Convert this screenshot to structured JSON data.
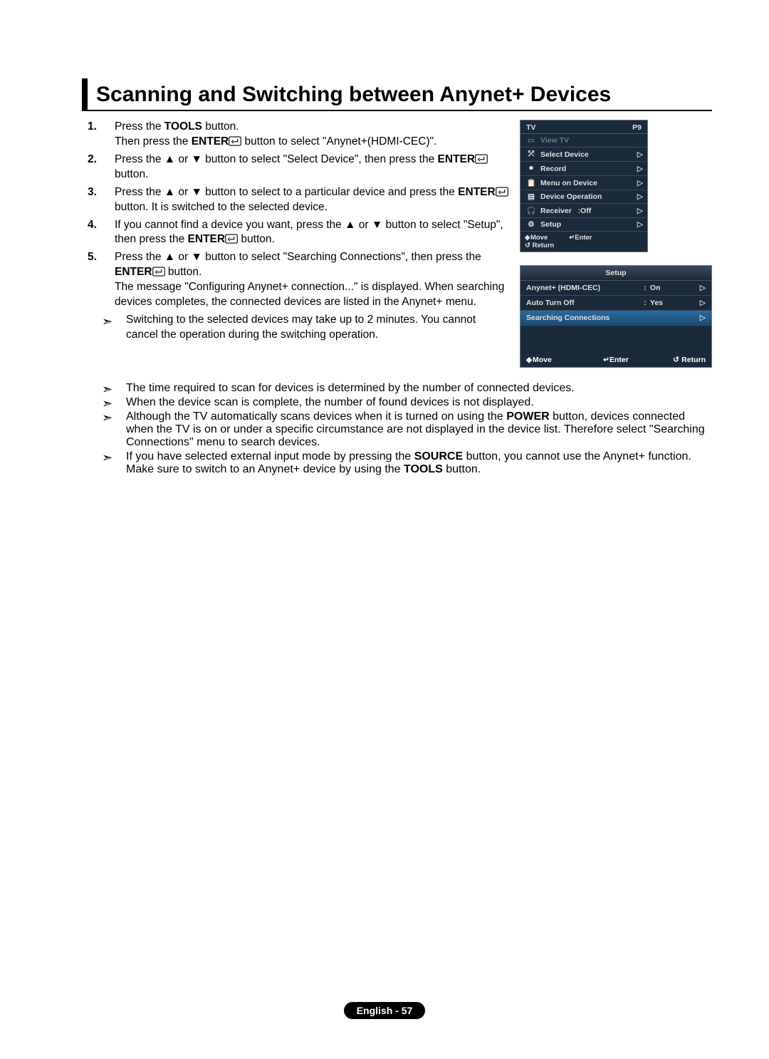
{
  "heading": "Scanning and Switching between Anynet+ Devices",
  "steps": {
    "s1a": "Press the ",
    "s1b": "TOOLS",
    "s1c": " button.",
    "s1d": "Then press the ",
    "s1e": "ENTER",
    "s1f": " button to select \"Anynet+(HDMI-CEC)\".",
    "s2a": "Press the ▲ or ▼ button to select \"Select Device\", then press the ",
    "s2b": "ENTER",
    "s2c": " button.",
    "s3a": "Press the ▲ or ▼ button to select to a particular device and press the ",
    "s3b": "ENTER",
    "s3c": " button. It is switched to the selected device.",
    "s4a": "If you cannot find a device you want, press the ▲ or ▼ button to select \"Setup\", then press the ",
    "s4b": "ENTER",
    "s4c": " button.",
    "s5a": "Press the ▲ or ▼ button to select \"Searching Connections\", then press the ",
    "s5b": "ENTER",
    "s5c": " button.",
    "s5d": "The message \"Configuring Anynet+ connection...\" is displayed. When searching devices completes, the connected devices are listed in the Anynet+ menu."
  },
  "notes": {
    "n1": "Switching to the selected devices may take up to 2 minutes. You cannot cancel the operation during the switching operation.",
    "n2": "The time required to scan for devices is determined by the number of connected devices.",
    "n3": "When the device scan is complete, the number of found devices is not displayed.",
    "n4a": "Although the TV automatically scans devices when it is turned on using the ",
    "n4b": "POWER",
    "n4c": " button, devices connected when the TV is on or under a specific circumstance are not displayed in the device list. Therefore select \"Searching Connections\" menu to search devices.",
    "n5a": "If you have selected external input mode by pressing the ",
    "n5b": "SOURCE",
    "n5c": " button, you cannot use the Anynet+ function. Make sure to switch to an Anynet+ device by using the ",
    "n5d": "TOOLS",
    "n5e": " button."
  },
  "fig1": {
    "title_left": "TV",
    "title_right": "P9",
    "rows": [
      {
        "icon": "▭",
        "label": "View TV",
        "arrow": "",
        "disabled": true
      },
      {
        "icon": "⤱",
        "label": "Select Device",
        "arrow": "▷",
        "disabled": false
      },
      {
        "icon": "⏺",
        "label": "Record",
        "arrow": "▷",
        "disabled": false
      },
      {
        "icon": "📋",
        "label": "Menu on Device",
        "arrow": "▷",
        "disabled": false
      },
      {
        "icon": "▤",
        "label": "Device Operation",
        "arrow": "▷",
        "disabled": false
      },
      {
        "icon": "🎧",
        "label": "Receiver",
        "suffix": ":Off",
        "arrow": "▷",
        "disabled": false
      },
      {
        "icon": "⚙",
        "label": "Setup",
        "arrow": "▷",
        "disabled": false
      }
    ],
    "foot_move": "Move",
    "foot_enter": "Enter",
    "foot_return": "Return"
  },
  "fig2": {
    "title": "Setup",
    "rows": [
      {
        "label": "Anynet+ (HDMI-CEC)",
        "val": "On",
        "colon": true,
        "arrow": true,
        "hl": false
      },
      {
        "label": "Auto Turn Off",
        "val": "Yes",
        "colon": true,
        "arrow": true,
        "hl": false
      },
      {
        "label": "Searching Connections",
        "val": "",
        "colon": false,
        "arrow": true,
        "hl": true
      }
    ],
    "foot_move": "Move",
    "foot_enter": "Enter",
    "foot_return": "Return"
  },
  "footer": "English - 57"
}
